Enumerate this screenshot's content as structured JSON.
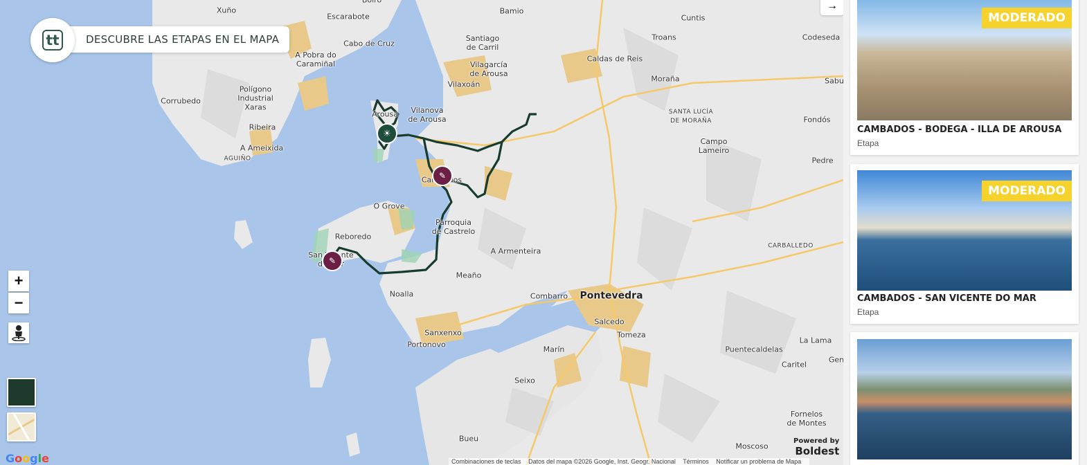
{
  "brand": {
    "logo_text": "tt",
    "label": "DESCUBRE LAS ETAPAS EN EL MAPA"
  },
  "map": {
    "places": [
      {
        "name": "Xuño",
        "cls": ""
      },
      {
        "name": "Escarabote",
        "cls": ""
      },
      {
        "name": "Boiro",
        "cls": ""
      },
      {
        "name": "Bamio",
        "cls": ""
      },
      {
        "name": "Cuntis",
        "cls": ""
      },
      {
        "name": "Codeseda",
        "cls": ""
      },
      {
        "name": "Cabo de Cruz",
        "cls": ""
      },
      {
        "name": "Santiago\nde Carril",
        "cls": ""
      },
      {
        "name": "Troans",
        "cls": ""
      },
      {
        "name": "A Pobra do\nCaramiñal",
        "cls": ""
      },
      {
        "name": "Caldas de Reis",
        "cls": ""
      },
      {
        "name": "Vilagarcía\nde Arousa",
        "cls": ""
      },
      {
        "name": "Moraña",
        "cls": ""
      },
      {
        "name": "Polígono\nIndustrial\nXaras",
        "cls": ""
      },
      {
        "name": "Corrubedo",
        "cls": ""
      },
      {
        "name": "Vilaxoán",
        "cls": ""
      },
      {
        "name": "Sabu",
        "cls": ""
      },
      {
        "name": "Vilanova\nde Arousa",
        "cls": ""
      },
      {
        "name": "SANTA LUCÍA\nDE MORAÑA",
        "cls": "small"
      },
      {
        "name": "Fondós",
        "cls": ""
      },
      {
        "name": "Ribeira",
        "cls": ""
      },
      {
        "name": "A Ameixida",
        "cls": ""
      },
      {
        "name": "Campo\nLameiro",
        "cls": ""
      },
      {
        "name": "AGUIÑO",
        "cls": "small"
      },
      {
        "name": "Pedre",
        "cls": ""
      },
      {
        "name": "O Grove",
        "cls": ""
      },
      {
        "name": "Parroquia\nde Castrelo",
        "cls": ""
      },
      {
        "name": "Reboredo",
        "cls": ""
      },
      {
        "name": "CARBALLEDO",
        "cls": "small"
      },
      {
        "name": "A Armenteira",
        "cls": ""
      },
      {
        "name": "Meaño",
        "cls": ""
      },
      {
        "name": "Noalla",
        "cls": ""
      },
      {
        "name": "Combarro",
        "cls": ""
      },
      {
        "name": "Pontevedra",
        "cls": "big"
      },
      {
        "name": "Salcedo",
        "cls": ""
      },
      {
        "name": "Sanxenxo",
        "cls": ""
      },
      {
        "name": "Tomeza",
        "cls": ""
      },
      {
        "name": "La Lama",
        "cls": ""
      },
      {
        "name": "Portonovo",
        "cls": ""
      },
      {
        "name": "Puentecaldelas",
        "cls": ""
      },
      {
        "name": "Marín",
        "cls": ""
      },
      {
        "name": "Caritel",
        "cls": ""
      },
      {
        "name": "Gen",
        "cls": ""
      },
      {
        "name": "Seixo",
        "cls": ""
      },
      {
        "name": "Fornelos\nde Montes",
        "cls": ""
      },
      {
        "name": "Bueu",
        "cls": ""
      },
      {
        "name": "Moscoso",
        "cls": ""
      },
      {
        "name": "Cambados",
        "cls": ""
      },
      {
        "name": "San Vicente\ndo Mar",
        "cls": ""
      },
      {
        "name": "Arousa",
        "cls": ""
      }
    ],
    "zoom_in": "+",
    "zoom_out": "−",
    "google": "Google",
    "footer": [
      "Combinaciones de teclas",
      "Datos del mapa ©2026 Google, Inst. Geogr. Nacional",
      "Términos",
      "Notificar un problema de Mapa"
    ],
    "powered_by": "Powered by",
    "powered_brand": "Boldest",
    "top_button": "→"
  },
  "colors": {
    "water": "#a9c6ea",
    "land": "#e9e9e9",
    "urban": "#e8c989",
    "route": "#173b2e",
    "marker": "#6b1f44",
    "badge": "#f6d32c"
  },
  "cards": [
    {
      "badge": "MODERADO",
      "title": "CAMBADOS - BODEGA - ILLA DE AROUSA",
      "sub": "Etapa"
    },
    {
      "badge": "MODERADO",
      "title": "CAMBADOS - SAN VICENTE DO MAR",
      "sub": "Etapa"
    },
    {
      "badge": "",
      "title": "",
      "sub": ""
    }
  ]
}
